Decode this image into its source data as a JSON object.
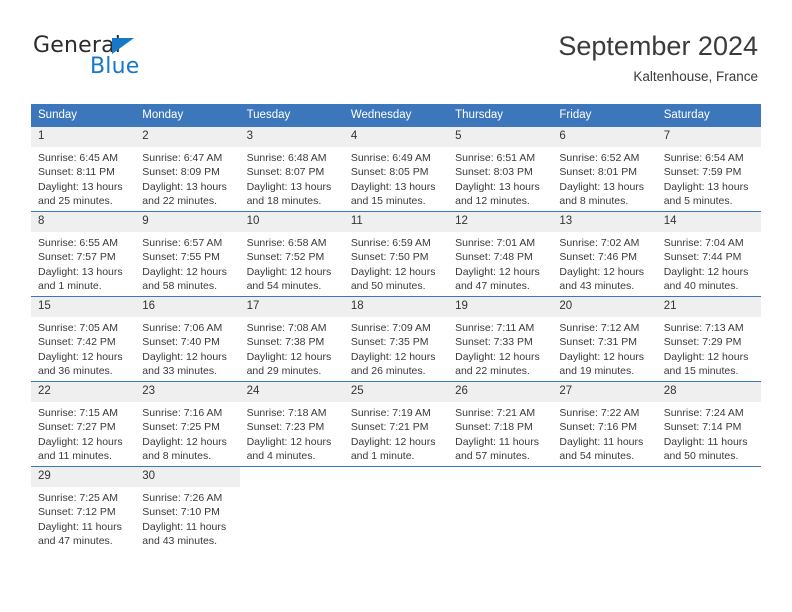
{
  "brand": {
    "name_part1": "General",
    "name_part2": "Blue",
    "accent_color": "#1878c8"
  },
  "header": {
    "title": "September 2024",
    "location": "Kaltenhouse, France"
  },
  "calendar": {
    "header_bg": "#3d77bb",
    "daynum_bg": "#efefef",
    "weekdays": [
      "Sunday",
      "Monday",
      "Tuesday",
      "Wednesday",
      "Thursday",
      "Friday",
      "Saturday"
    ],
    "weeks": [
      [
        {
          "day": "1",
          "sunrise": "Sunrise: 6:45 AM",
          "sunset": "Sunset: 8:11 PM",
          "daylight_line1": "Daylight: 13 hours",
          "daylight_line2": "and 25 minutes."
        },
        {
          "day": "2",
          "sunrise": "Sunrise: 6:47 AM",
          "sunset": "Sunset: 8:09 PM",
          "daylight_line1": "Daylight: 13 hours",
          "daylight_line2": "and 22 minutes."
        },
        {
          "day": "3",
          "sunrise": "Sunrise: 6:48 AM",
          "sunset": "Sunset: 8:07 PM",
          "daylight_line1": "Daylight: 13 hours",
          "daylight_line2": "and 18 minutes."
        },
        {
          "day": "4",
          "sunrise": "Sunrise: 6:49 AM",
          "sunset": "Sunset: 8:05 PM",
          "daylight_line1": "Daylight: 13 hours",
          "daylight_line2": "and 15 minutes."
        },
        {
          "day": "5",
          "sunrise": "Sunrise: 6:51 AM",
          "sunset": "Sunset: 8:03 PM",
          "daylight_line1": "Daylight: 13 hours",
          "daylight_line2": "and 12 minutes."
        },
        {
          "day": "6",
          "sunrise": "Sunrise: 6:52 AM",
          "sunset": "Sunset: 8:01 PM",
          "daylight_line1": "Daylight: 13 hours",
          "daylight_line2": "and 8 minutes."
        },
        {
          "day": "7",
          "sunrise": "Sunrise: 6:54 AM",
          "sunset": "Sunset: 7:59 PM",
          "daylight_line1": "Daylight: 13 hours",
          "daylight_line2": "and 5 minutes."
        }
      ],
      [
        {
          "day": "8",
          "sunrise": "Sunrise: 6:55 AM",
          "sunset": "Sunset: 7:57 PM",
          "daylight_line1": "Daylight: 13 hours",
          "daylight_line2": "and 1 minute."
        },
        {
          "day": "9",
          "sunrise": "Sunrise: 6:57 AM",
          "sunset": "Sunset: 7:55 PM",
          "daylight_line1": "Daylight: 12 hours",
          "daylight_line2": "and 58 minutes."
        },
        {
          "day": "10",
          "sunrise": "Sunrise: 6:58 AM",
          "sunset": "Sunset: 7:52 PM",
          "daylight_line1": "Daylight: 12 hours",
          "daylight_line2": "and 54 minutes."
        },
        {
          "day": "11",
          "sunrise": "Sunrise: 6:59 AM",
          "sunset": "Sunset: 7:50 PM",
          "daylight_line1": "Daylight: 12 hours",
          "daylight_line2": "and 50 minutes."
        },
        {
          "day": "12",
          "sunrise": "Sunrise: 7:01 AM",
          "sunset": "Sunset: 7:48 PM",
          "daylight_line1": "Daylight: 12 hours",
          "daylight_line2": "and 47 minutes."
        },
        {
          "day": "13",
          "sunrise": "Sunrise: 7:02 AM",
          "sunset": "Sunset: 7:46 PM",
          "daylight_line1": "Daylight: 12 hours",
          "daylight_line2": "and 43 minutes."
        },
        {
          "day": "14",
          "sunrise": "Sunrise: 7:04 AM",
          "sunset": "Sunset: 7:44 PM",
          "daylight_line1": "Daylight: 12 hours",
          "daylight_line2": "and 40 minutes."
        }
      ],
      [
        {
          "day": "15",
          "sunrise": "Sunrise: 7:05 AM",
          "sunset": "Sunset: 7:42 PM",
          "daylight_line1": "Daylight: 12 hours",
          "daylight_line2": "and 36 minutes."
        },
        {
          "day": "16",
          "sunrise": "Sunrise: 7:06 AM",
          "sunset": "Sunset: 7:40 PM",
          "daylight_line1": "Daylight: 12 hours",
          "daylight_line2": "and 33 minutes."
        },
        {
          "day": "17",
          "sunrise": "Sunrise: 7:08 AM",
          "sunset": "Sunset: 7:38 PM",
          "daylight_line1": "Daylight: 12 hours",
          "daylight_line2": "and 29 minutes."
        },
        {
          "day": "18",
          "sunrise": "Sunrise: 7:09 AM",
          "sunset": "Sunset: 7:35 PM",
          "daylight_line1": "Daylight: 12 hours",
          "daylight_line2": "and 26 minutes."
        },
        {
          "day": "19",
          "sunrise": "Sunrise: 7:11 AM",
          "sunset": "Sunset: 7:33 PM",
          "daylight_line1": "Daylight: 12 hours",
          "daylight_line2": "and 22 minutes."
        },
        {
          "day": "20",
          "sunrise": "Sunrise: 7:12 AM",
          "sunset": "Sunset: 7:31 PM",
          "daylight_line1": "Daylight: 12 hours",
          "daylight_line2": "and 19 minutes."
        },
        {
          "day": "21",
          "sunrise": "Sunrise: 7:13 AM",
          "sunset": "Sunset: 7:29 PM",
          "daylight_line1": "Daylight: 12 hours",
          "daylight_line2": "and 15 minutes."
        }
      ],
      [
        {
          "day": "22",
          "sunrise": "Sunrise: 7:15 AM",
          "sunset": "Sunset: 7:27 PM",
          "daylight_line1": "Daylight: 12 hours",
          "daylight_line2": "and 11 minutes."
        },
        {
          "day": "23",
          "sunrise": "Sunrise: 7:16 AM",
          "sunset": "Sunset: 7:25 PM",
          "daylight_line1": "Daylight: 12 hours",
          "daylight_line2": "and 8 minutes."
        },
        {
          "day": "24",
          "sunrise": "Sunrise: 7:18 AM",
          "sunset": "Sunset: 7:23 PM",
          "daylight_line1": "Daylight: 12 hours",
          "daylight_line2": "and 4 minutes."
        },
        {
          "day": "25",
          "sunrise": "Sunrise: 7:19 AM",
          "sunset": "Sunset: 7:21 PM",
          "daylight_line1": "Daylight: 12 hours",
          "daylight_line2": "and 1 minute."
        },
        {
          "day": "26",
          "sunrise": "Sunrise: 7:21 AM",
          "sunset": "Sunset: 7:18 PM",
          "daylight_line1": "Daylight: 11 hours",
          "daylight_line2": "and 57 minutes."
        },
        {
          "day": "27",
          "sunrise": "Sunrise: 7:22 AM",
          "sunset": "Sunset: 7:16 PM",
          "daylight_line1": "Daylight: 11 hours",
          "daylight_line2": "and 54 minutes."
        },
        {
          "day": "28",
          "sunrise": "Sunrise: 7:24 AM",
          "sunset": "Sunset: 7:14 PM",
          "daylight_line1": "Daylight: 11 hours",
          "daylight_line2": "and 50 minutes."
        }
      ],
      [
        {
          "day": "29",
          "sunrise": "Sunrise: 7:25 AM",
          "sunset": "Sunset: 7:12 PM",
          "daylight_line1": "Daylight: 11 hours",
          "daylight_line2": "and 47 minutes."
        },
        {
          "day": "30",
          "sunrise": "Sunrise: 7:26 AM",
          "sunset": "Sunset: 7:10 PM",
          "daylight_line1": "Daylight: 11 hours",
          "daylight_line2": "and 43 minutes."
        },
        {
          "day": "",
          "sunrise": "",
          "sunset": "",
          "daylight_line1": "",
          "daylight_line2": ""
        },
        {
          "day": "",
          "sunrise": "",
          "sunset": "",
          "daylight_line1": "",
          "daylight_line2": ""
        },
        {
          "day": "",
          "sunrise": "",
          "sunset": "",
          "daylight_line1": "",
          "daylight_line2": ""
        },
        {
          "day": "",
          "sunrise": "",
          "sunset": "",
          "daylight_line1": "",
          "daylight_line2": ""
        },
        {
          "day": "",
          "sunrise": "",
          "sunset": "",
          "daylight_line1": "",
          "daylight_line2": ""
        }
      ]
    ]
  }
}
